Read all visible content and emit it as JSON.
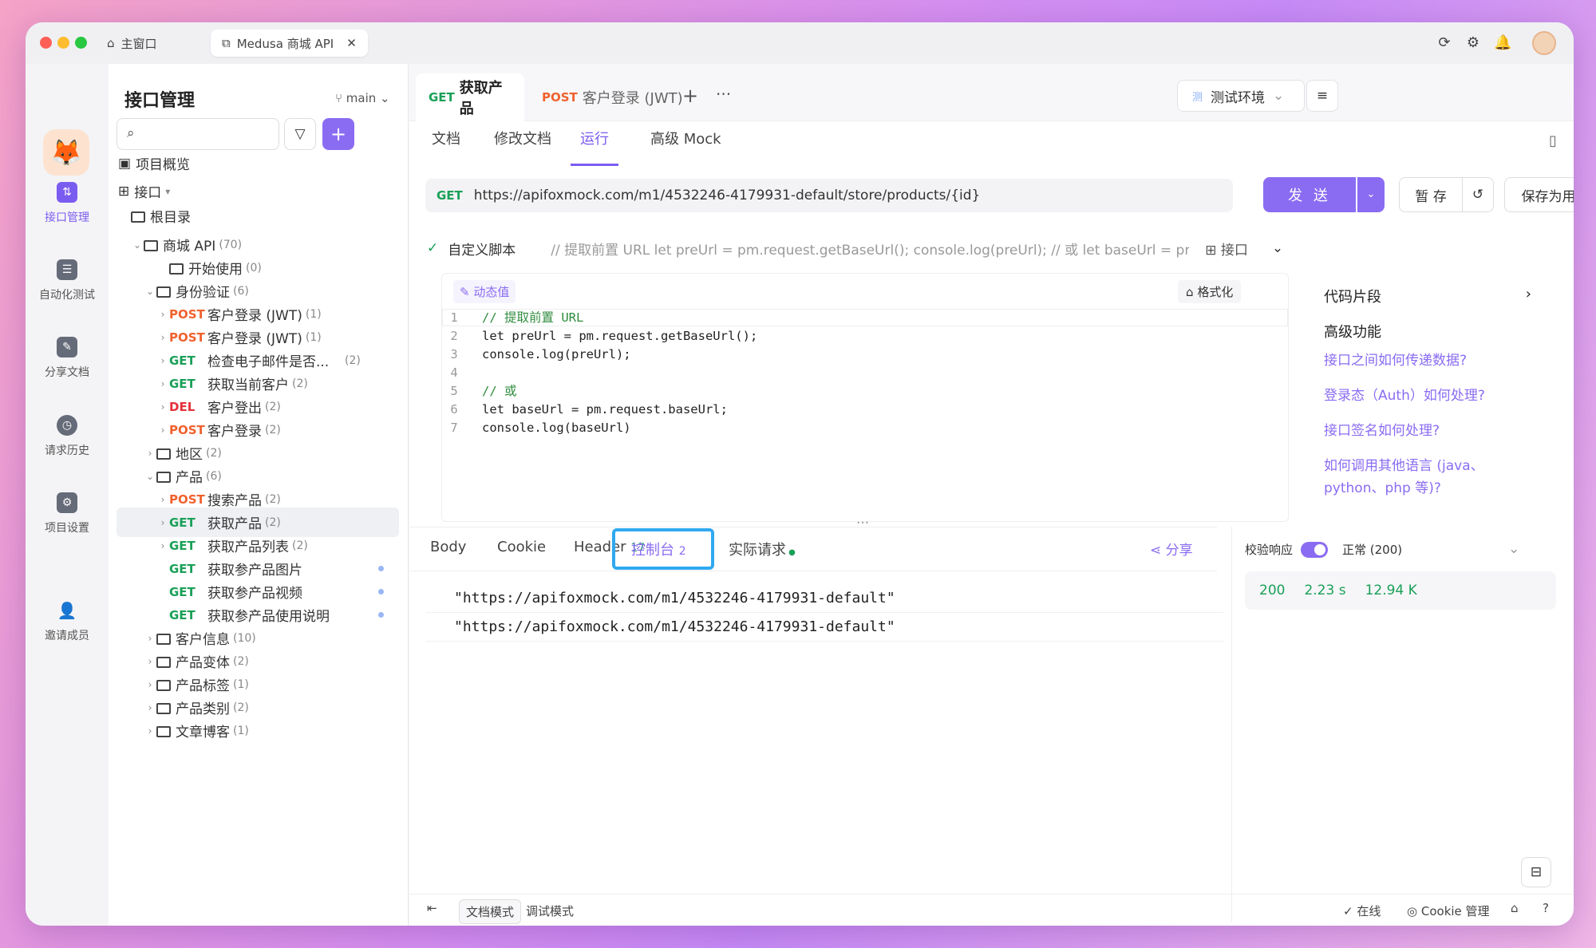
{
  "titlebar": {
    "home_tab": "主窗口",
    "project_tab": "Medusa 商城 API"
  },
  "rail": {
    "items": [
      {
        "label": "接口管理"
      },
      {
        "label": "自动化测试"
      },
      {
        "label": "分享文档"
      },
      {
        "label": "请求历史"
      },
      {
        "label": "项目设置"
      },
      {
        "label": "邀请成员"
      }
    ]
  },
  "sidebar": {
    "title": "接口管理",
    "branch": "main",
    "overview": "项目概览",
    "api_root": "接口",
    "root_dir": "根目录",
    "tree": [
      {
        "type": "folder",
        "label": "商城 API",
        "count": "(70)"
      },
      {
        "type": "folder",
        "label": "开始使用",
        "count": "(0)"
      },
      {
        "type": "folder",
        "label": "身份验证",
        "count": "(6)"
      },
      {
        "method": "POST",
        "label": "客户登录 (JWT)",
        "count": "(1)"
      },
      {
        "method": "POST",
        "label": "客户登录 (JWT)",
        "count": "(1)"
      },
      {
        "method": "GET",
        "label": "检查电子邮件是否...",
        "count": "(2)"
      },
      {
        "method": "GET",
        "label": "获取当前客户",
        "count": "(2)"
      },
      {
        "method": "DEL",
        "label": "客户登出",
        "count": "(2)"
      },
      {
        "method": "POST",
        "label": "客户登录",
        "count": "(2)"
      },
      {
        "type": "folder",
        "label": "地区",
        "count": "(2)"
      },
      {
        "type": "folder",
        "label": "产品",
        "count": "(6)"
      },
      {
        "method": "POST",
        "label": "搜索产品",
        "count": "(2)"
      },
      {
        "method": "GET",
        "label": "获取产品",
        "count": "(2)"
      },
      {
        "method": "GET",
        "label": "获取产品列表",
        "count": "(2)"
      },
      {
        "method": "GET",
        "label": "获取参产品图片",
        "count": ""
      },
      {
        "method": "GET",
        "label": "获取参产品视频",
        "count": ""
      },
      {
        "method": "GET",
        "label": "获取参产品使用说明",
        "count": ""
      },
      {
        "type": "folder",
        "label": "客户信息",
        "count": "(10)"
      },
      {
        "type": "folder",
        "label": "产品变体",
        "count": "(2)"
      },
      {
        "type": "folder",
        "label": "产品标签",
        "count": "(1)"
      },
      {
        "type": "folder",
        "label": "产品类别",
        "count": "(2)"
      },
      {
        "type": "folder",
        "label": "文章博客",
        "count": "(1)"
      }
    ]
  },
  "tabs": [
    {
      "method": "GET",
      "label": "获取产品"
    },
    {
      "method": "POST",
      "label": "客户登录 (JWT)"
    }
  ],
  "env": "测试环境",
  "env_badge": "测",
  "subtabs": [
    "文档",
    "修改文档",
    "运行",
    "高级 Mock"
  ],
  "request": {
    "method": "GET",
    "url": "https://apifoxmock.com/m1/4532246-4179931-default/store/products/{id}",
    "send": "发 送",
    "save": "暂 存",
    "save_case": "保存为用例"
  },
  "script": {
    "title": "自定义脚本",
    "preview": "// 提取前置 URL let preUrl = pm.request.getBaseUrl(); console.log(preUrl); // 或 let baseUrl = pm.request.baseUrl; console.log(...",
    "scope": "接口",
    "dynamic": "动态值",
    "format": "格式化",
    "lines": [
      [
        "1",
        "// 提取前置 URL"
      ],
      [
        "2",
        "let preUrl = pm.request.getBaseUrl();"
      ],
      [
        "3",
        "console.log(preUrl);"
      ],
      [
        "4",
        ""
      ],
      [
        "5",
        "// 或"
      ],
      [
        "6",
        "let baseUrl = pm.request.baseUrl;"
      ],
      [
        "7",
        "console.log(baseUrl)"
      ]
    ]
  },
  "snippets": {
    "title": "代码片段",
    "advanced": "高级功能",
    "links": [
      "接口之间如何传递数据?",
      "登录态（Auth）如何处理?",
      "接口签名如何处理?",
      "如何调用其他语言 (java、python、php 等)?"
    ]
  },
  "response": {
    "tabs": {
      "body": "Body",
      "cookie": "Cookie",
      "header": "Header",
      "header_count": "17",
      "console": "控制台",
      "console_count": "2",
      "actual": "实际请求"
    },
    "share": "分享",
    "console_lines": [
      "\"https://apifoxmock.com/m1/4532246-4179931-default\"",
      "\"https://apifoxmock.com/m1/4532246-4179931-default\""
    ],
    "verify_label": "校验响应",
    "verify_status": "正常 (200)",
    "status_code": "200",
    "time": "2.23 s",
    "size": "12.94 K"
  },
  "footer": {
    "doc_mode": "文档模式",
    "debug_mode": "调试模式",
    "online": "在线",
    "cookie_mgr": "Cookie 管理"
  }
}
